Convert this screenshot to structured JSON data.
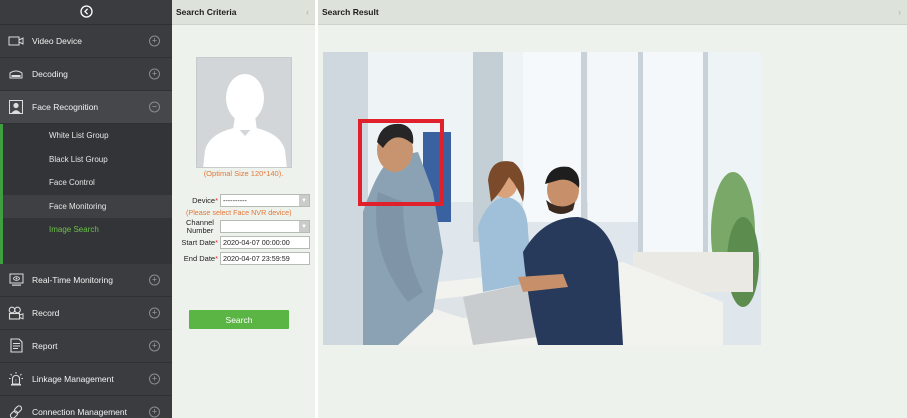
{
  "sidebar": {
    "collapse_icon": "circle-chevron-left-icon",
    "items": [
      {
        "label": "Video Device",
        "icon": "video-camera-icon",
        "toggle": "⊕"
      },
      {
        "label": "Decoding",
        "icon": "decoder-icon",
        "toggle": "⊕"
      },
      {
        "label": "Face Recognition",
        "icon": "face-icon",
        "toggle": "⊖"
      },
      {
        "label": "Real-Time Monitoring",
        "icon": "monitor-icon",
        "toggle": "⊕"
      },
      {
        "label": "Record",
        "icon": "record-icon",
        "toggle": "⊕"
      },
      {
        "label": "Report",
        "icon": "report-icon",
        "toggle": "⊕"
      },
      {
        "label": "Linkage Management",
        "icon": "alarm-icon",
        "toggle": "⊕"
      },
      {
        "label": "Connection Management",
        "icon": "link-icon",
        "toggle": "⊕"
      }
    ],
    "submenu": [
      "White List Group",
      "Black List Group",
      "Face Control",
      "Face Monitoring",
      "Image Search"
    ]
  },
  "criteria": {
    "title": "Search Criteria",
    "optimal_size": "(Optimal Size 120*140).",
    "device_label": "Device",
    "device_value": "----------",
    "device_hint": "(Please select Face NVR device)",
    "channel_label_1": "Channel",
    "channel_label_2": "Number",
    "channel_value": "",
    "start_label": "Start Date",
    "start_value": "2020-04-07 00:00:00",
    "end_label": "End Date",
    "end_value": "2020-04-07 23:59:59",
    "search_button": "Search"
  },
  "results": {
    "title": "Search Result"
  },
  "colors": {
    "sidebar_bg": "#3a3c3f",
    "accent_green": "#5bb545",
    "hint_orange": "#e1783a",
    "face_box_red": "#e0202a"
  }
}
